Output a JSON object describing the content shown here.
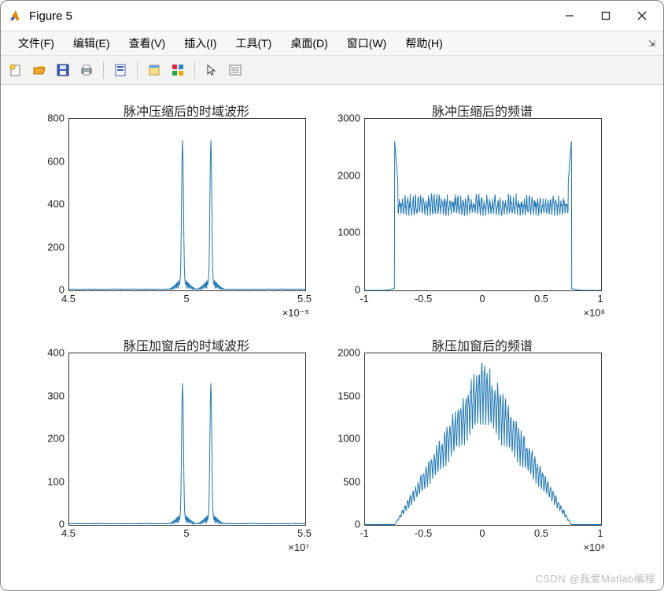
{
  "window": {
    "title": "Figure 5"
  },
  "menu": {
    "file": "文件(F)",
    "edit": "编辑(E)",
    "view": "查看(V)",
    "insert": "插入(I)",
    "tools": "工具(T)",
    "desktop": "桌面(D)",
    "window": "窗口(W)",
    "help": "帮助(H)"
  },
  "toolbar_icons": [
    "new",
    "open",
    "save",
    "print",
    "|",
    "print-preview",
    "|",
    "link",
    "color-order",
    "|",
    "pointer",
    "data-cursor"
  ],
  "watermark": "CSDN @我爱Matlab编程",
  "chart_data": [
    {
      "id": "tl",
      "type": "line",
      "title": "脉冲压缩后的时域波形",
      "xlabel": "",
      "ylabel": "",
      "xlim": [
        4.5,
        5.5
      ],
      "xexp": "×10⁻⁵",
      "xticks": [
        4.5,
        5,
        5.5
      ],
      "ylim": [
        0,
        800
      ],
      "yticks": [
        0,
        200,
        400,
        600,
        800
      ],
      "peaks_x": [
        4.98,
        5.1
      ],
      "peak_heights": [
        700,
        700
      ],
      "baseline": 15,
      "description": "Two sharp time-domain pulses near x≈5.0e-5 and 5.1e-5 with sidelobes"
    },
    {
      "id": "tr",
      "type": "line",
      "title": "脉冲压缩后的频谱",
      "xlabel": "",
      "ylabel": "",
      "xlim": [
        -1,
        1
      ],
      "xexp": "×10⁸",
      "xticks": [
        -1,
        -0.5,
        0,
        0.5,
        1
      ],
      "ylim": [
        0,
        3000
      ],
      "yticks": [
        0,
        1000,
        2000,
        3000
      ],
      "band": [
        -0.75,
        0.75
      ],
      "edge_peak": 2650,
      "inband_mean": 1500,
      "ripple": 400,
      "description": "Flat-top rippled spectrum ~1500 across ±0.75e8 band, edge spikes ~2650, near-zero outside"
    },
    {
      "id": "bl",
      "type": "line",
      "title": "脉压加窗后的时域波形",
      "xlabel": "",
      "ylabel": "",
      "xlim": [
        4.5,
        5.5
      ],
      "xexp": "×10⁷",
      "xticks": [
        4.5,
        5,
        5.5
      ],
      "ylim": [
        0,
        400
      ],
      "yticks": [
        0,
        100,
        200,
        300,
        400
      ],
      "peaks_x": [
        4.98,
        5.1
      ],
      "peak_heights": [
        330,
        330
      ],
      "baseline": 8,
      "description": "Two sharp windowed pulses, reduced sidelobes, peaks ≈330"
    },
    {
      "id": "br",
      "type": "line",
      "title": "脉压加窗后的频谱",
      "xlabel": "",
      "ylabel": "",
      "xlim": [
        -1,
        1
      ],
      "xexp": "×10⁸",
      "xticks": [
        -1,
        -0.5,
        0,
        0.5,
        1
      ],
      "ylim": [
        0,
        2000
      ],
      "yticks": [
        0,
        500,
        1000,
        1500,
        2000
      ],
      "band": [
        -0.75,
        0.75
      ],
      "peak_center": 1950,
      "description": "Rippled triangular/window-shaped spectrum, apex ≈1950 at x=0, tapering to 0 at ±0.75e8"
    }
  ]
}
